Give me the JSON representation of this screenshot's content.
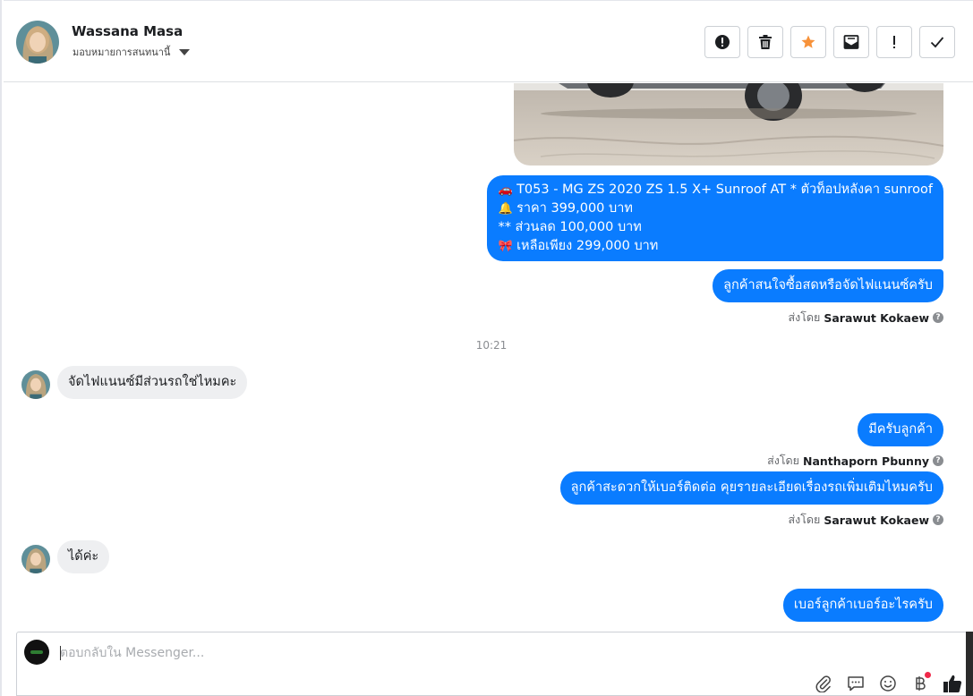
{
  "header": {
    "contact_name": "Wassana Masa",
    "assign_label": "มอบหมายการสนทนานี้"
  },
  "actions": [
    {
      "name": "report-button",
      "icon": "exclamation-circle-icon"
    },
    {
      "name": "delete-button",
      "icon": "trash-icon"
    },
    {
      "name": "star-button",
      "icon": "star-icon"
    },
    {
      "name": "mark-unread-button",
      "icon": "envelope-icon"
    },
    {
      "name": "spam-button",
      "icon": "exclamation-icon"
    },
    {
      "name": "done-button",
      "icon": "check-icon"
    }
  ],
  "messages": {
    "offer": {
      "line1_emoji": "🚗",
      "line1": "T053 - MG ZS 2020 ZS 1.5 X+ Sunroof AT  * ตัวท็อปหลังคา sunroof",
      "line2_emoji": "🔔",
      "line2": " ราคา 399,000 บาท",
      "line3": "** ส่วนลด 100,000 บาท",
      "line4_emoji": "🎀",
      "line4": "เหลือเพียง 299,000 บาท"
    },
    "ask_payment": "ลูกค้าสนใจซื้อสดหรือจัดไฟแนนซ์ครับ",
    "sent_by_prefix": "ส่งโดย",
    "sender_1": "Sarawut Kokaew",
    "time": "10:21",
    "customer_q": "จัดไฟแนนซ์มีส่วนรถใช่ไหมคะ",
    "answer_yes": "มีครับลูกค้า",
    "sender_2": "Nanthaporn Pbunny",
    "ask_phone": "ลูกค้าสะดวกให้เบอร์ติดต่อ คุยรายละเอียดเรื่องรถเพิ่มเติมไหมครับ",
    "sender_3": "Sarawut Kokaew",
    "customer_ok": "ได้ค่ะ",
    "ask_number": "เบอร์ลูกค้าเบอร์อะไรครับ"
  },
  "composer": {
    "placeholder": "ตอบกลับใน Messenger..."
  },
  "colors": {
    "outgoing_bubble": "#0a7cff",
    "incoming_bubble": "#eeeff1",
    "star": "#f7923a",
    "notification_dot": "#f02849"
  }
}
